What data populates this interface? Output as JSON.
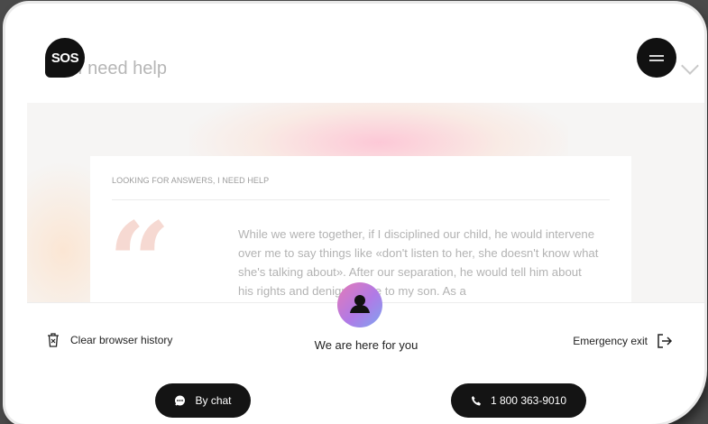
{
  "header": {
    "logo_text": "SOS",
    "title": "I need help"
  },
  "card": {
    "kicker": "LOOKING FOR ANSWERS, I NEED HELP",
    "quote_mark": "“",
    "quote": "While we were together, if I disciplined our child, he would intervene over me to say things like «don't listen to her, she doesn't know what she's talking about». After our separation, he would tell him about his rights and denigrate me to my son. As a"
  },
  "bottom_bar": {
    "clear_history": "Clear browser history",
    "center_label": "We are here for you",
    "emergency_exit": "Emergency exit",
    "chat_button": "By chat",
    "phone_button": "1 800 363-9010"
  },
  "colors": {
    "accent_dark": "#141414",
    "avatar_gradient": [
      "#e47ab7",
      "#b07ae6",
      "#7ea4f0"
    ],
    "quote_mark": "#f6d9d2"
  },
  "icons": [
    "menu-icon",
    "chevron-down-icon",
    "trash-icon",
    "user-icon",
    "exit-icon",
    "chat-icon",
    "phone-icon"
  ]
}
